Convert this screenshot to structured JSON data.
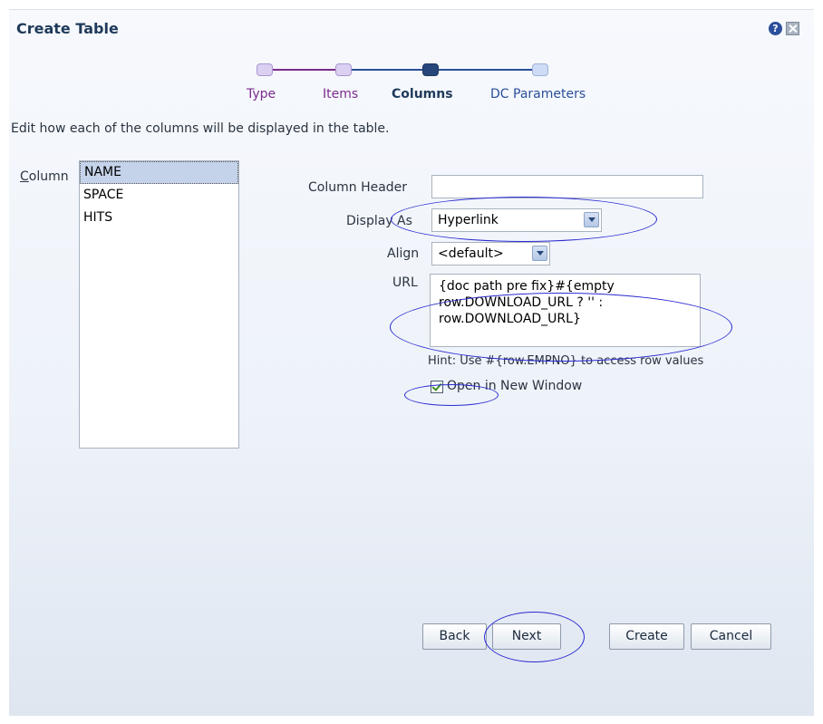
{
  "dialog": {
    "title": "Create Table",
    "help_icon": "help-icon",
    "close_icon": "close-icon"
  },
  "train": {
    "steps": [
      {
        "label": "Type",
        "state": "visited"
      },
      {
        "label": "Items",
        "state": "visited"
      },
      {
        "label": "Columns",
        "state": "current"
      },
      {
        "label": "DC Parameters",
        "state": "unvisited"
      }
    ],
    "colors": {
      "visited": "#7b2c8c",
      "current": "#1f3a5a",
      "unvisited": "#2b4f9a"
    }
  },
  "instructions": "Edit how each of the columns will be displayed in the table.",
  "column": {
    "label": "Column",
    "items": [
      "NAME",
      "SPACE",
      "HITS"
    ],
    "selected": "NAME"
  },
  "form": {
    "column_header_label": "Column Header",
    "column_header_value": "",
    "display_as_label": "Display As",
    "display_as_value": "Hyperlink",
    "align_label": "Align",
    "align_value": "<default>",
    "url_label": "URL",
    "url_value": "{doc path pre fix}#{empty\nrow.DOWNLOAD_URL ? '' :\nrow.DOWNLOAD_URL}",
    "hint": "Hint: Use #{row.EMPNO} to access row values",
    "open_new_window_label": "Open in New Window",
    "open_new_window_checked": true
  },
  "buttons": {
    "back": "Back",
    "next": "Next",
    "create": "Create",
    "cancel": "Cancel"
  }
}
